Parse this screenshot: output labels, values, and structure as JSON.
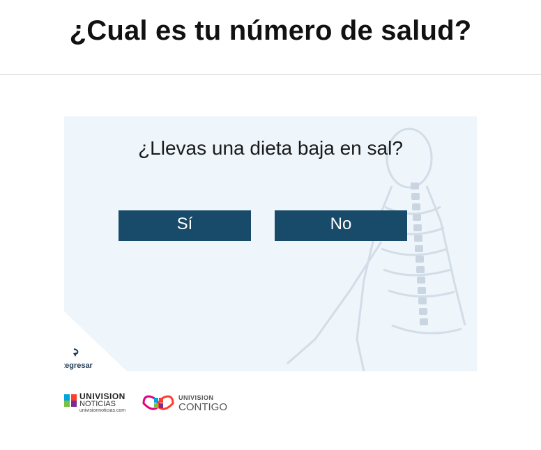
{
  "header": {
    "title": "¿Cual es tu número de salud?"
  },
  "quiz": {
    "question": "¿Llevas una dieta baja en sal?",
    "answers": [
      {
        "label": "Sí"
      },
      {
        "label": "No"
      }
    ],
    "back_label": "Regresar",
    "background_icon": "human-anatomy-skeleton"
  },
  "footer": {
    "logos": [
      {
        "name": "univision-noticias-logo",
        "line1": "UNIVISION",
        "line2": "NOTICIAS",
        "line3": "univisionnoticias.com"
      },
      {
        "name": "univision-contigo-logo",
        "line1": "UNIVISION",
        "line2": "CONTIGO"
      }
    ]
  },
  "colors": {
    "button": "#184a69",
    "panel": "#eef5fb",
    "title": "#111111"
  }
}
